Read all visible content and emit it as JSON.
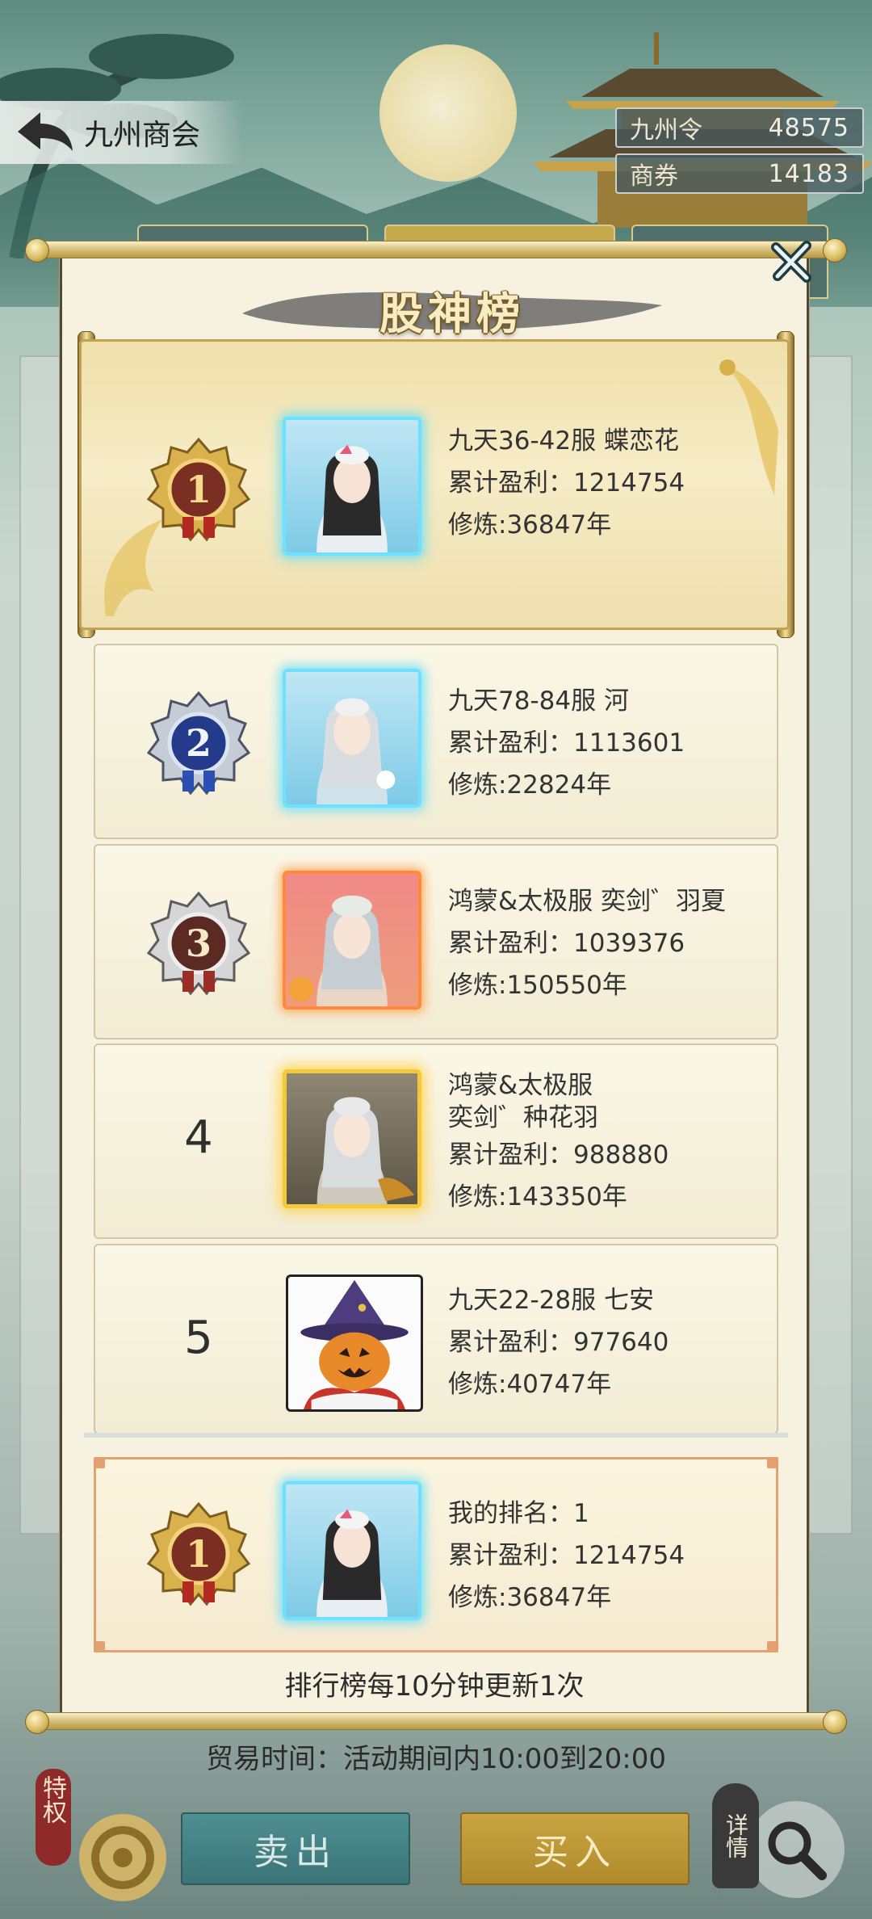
{
  "header": {
    "title": "九州商会",
    "currencies": [
      {
        "label": "九州令",
        "value": "48575"
      },
      {
        "label": "商券",
        "value": "14183"
      }
    ]
  },
  "modal": {
    "title": "股神榜",
    "profit_label": "累计盈利：",
    "cultivation_label": "修炼:",
    "ranking": [
      {
        "rank": "1",
        "server": "九天36-42服",
        "name": "蝶恋花",
        "profit": "1214754",
        "cultivation": "36847年",
        "frame": "blue"
      },
      {
        "rank": "2",
        "server": "九天78-84服",
        "name": "河",
        "profit": "1113601",
        "cultivation": "22824年",
        "frame": "blue"
      },
      {
        "rank": "3",
        "server": "鸿蒙&太极服",
        "name": "奕剑゛羽夏",
        "profit": "1039376",
        "cultivation": "150550年",
        "frame": "red"
      },
      {
        "rank": "4",
        "server": "鸿蒙&太极服",
        "name": "奕剑゛种花羽",
        "profit": "988880",
        "cultivation": "143350年",
        "frame": "gold"
      },
      {
        "rank": "5",
        "server": "九天22-28服",
        "name": "七安",
        "profit": "977640",
        "cultivation": "40747年",
        "frame": "plain"
      }
    ],
    "my_rank": {
      "label": "我的排名：",
      "rank": "1",
      "profit": "1214754",
      "cultivation": "36847年"
    },
    "update_note": "排行榜每10分钟更新1次"
  },
  "footer": {
    "trade_time": "贸易时间：活动期间内10:00到20:00",
    "sell_label": "卖出",
    "buy_label": "买入",
    "privilege_label": "特权",
    "detail_label": "详情"
  },
  "icons": {
    "back": "back-arrow-icon",
    "close": "close-icon",
    "search": "search-icon",
    "medal": "rank-medal-icon"
  },
  "colors": {
    "gold": "#c9a542",
    "teal": "#4e8f92",
    "paper": "#f7f2df"
  }
}
